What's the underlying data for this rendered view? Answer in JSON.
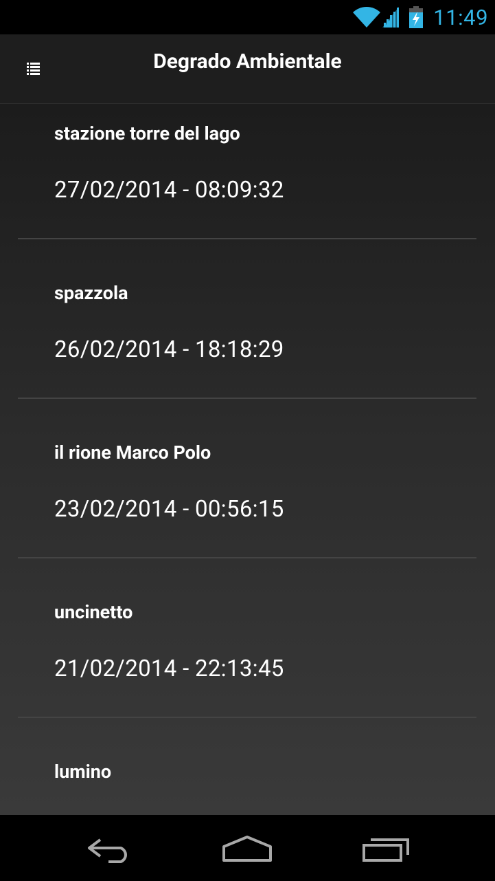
{
  "status_bar": {
    "time": "11:49",
    "icons": [
      "wifi-icon",
      "signal-icon",
      "battery-charging-icon"
    ],
    "accent_color": "#33b5e5"
  },
  "action_bar": {
    "title": "Degrado Ambientale",
    "menu_icon": "list-menu-icon"
  },
  "list": {
    "items": [
      {
        "name": "stazione torre del lago",
        "date": "27/02/2014 - 08:09:32"
      },
      {
        "name": "spazzola",
        "date": "26/02/2014 - 18:18:29"
      },
      {
        "name": "il rione Marco Polo",
        "date": "23/02/2014 - 00:56:15"
      },
      {
        "name": "uncinetto",
        "date": "21/02/2014 - 22:13:45"
      },
      {
        "name": "lumino",
        "date": ""
      }
    ]
  },
  "nav_bar": {
    "buttons": [
      "back-icon",
      "home-icon",
      "recent-apps-icon"
    ]
  }
}
